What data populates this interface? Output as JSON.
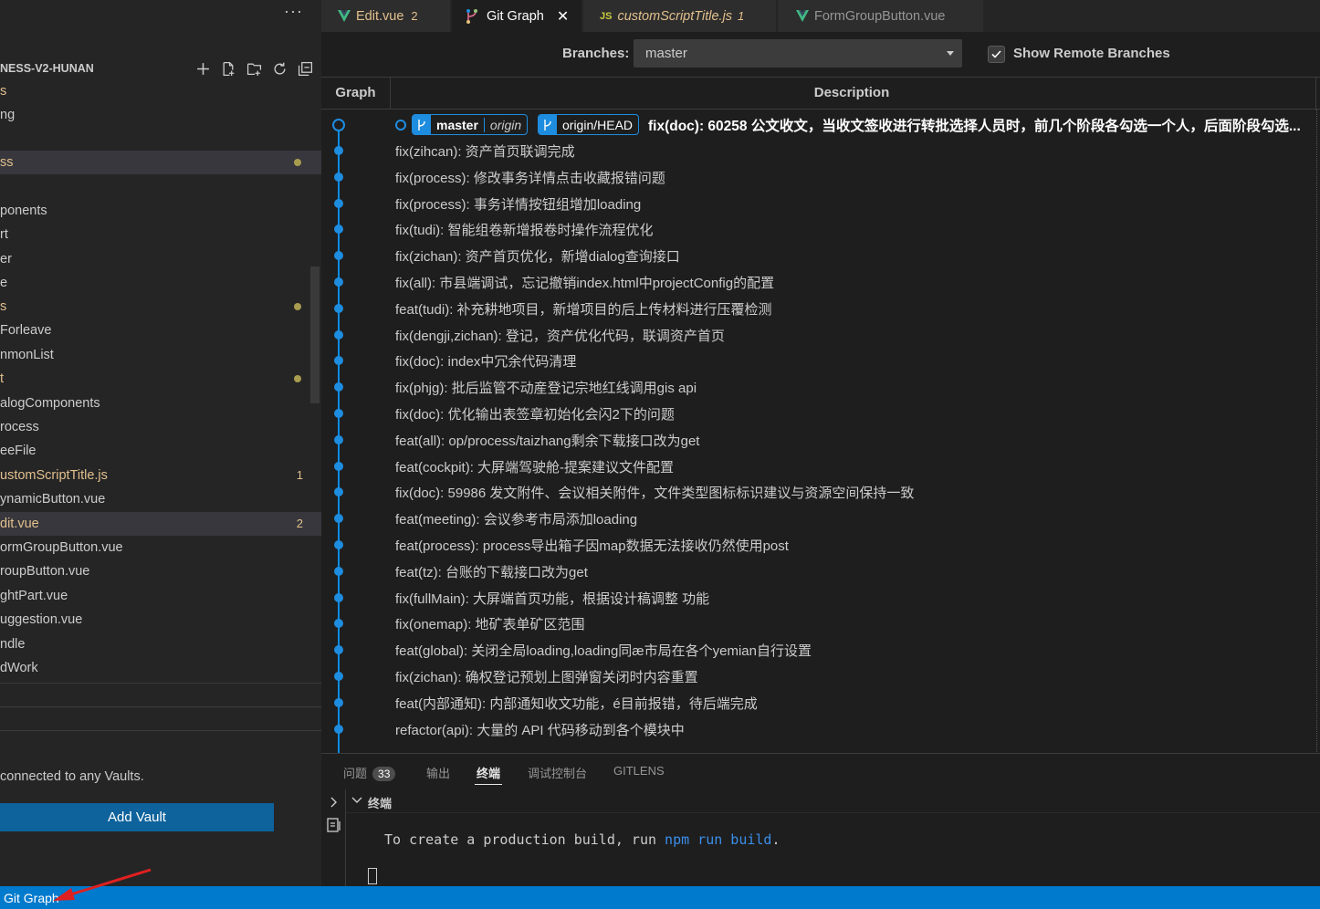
{
  "sidebar": {
    "more_label": "···",
    "project_title": "NESS-V2-HUNAN",
    "items": [
      {
        "label": "s",
        "mod": true,
        "sel": false,
        "dot": false,
        "count": ""
      },
      {
        "label": "ng",
        "mod": false,
        "sel": false,
        "dot": false,
        "count": ""
      },
      {
        "label": "ss",
        "mod": true,
        "sel": true,
        "dot": true,
        "count": ""
      },
      {
        "label": "ponents",
        "mod": false,
        "sel": false,
        "dot": false,
        "count": ""
      },
      {
        "label": "rt",
        "mod": false,
        "sel": false,
        "dot": false,
        "count": ""
      },
      {
        "label": "er",
        "mod": false,
        "sel": false,
        "dot": false,
        "count": ""
      },
      {
        "label": "e",
        "mod": false,
        "sel": false,
        "dot": false,
        "count": ""
      },
      {
        "label": "s",
        "mod": true,
        "sel": false,
        "dot": true,
        "count": ""
      },
      {
        "label": "Forleave",
        "mod": false,
        "sel": false,
        "dot": false,
        "count": ""
      },
      {
        "label": "nmonList",
        "mod": false,
        "sel": false,
        "dot": false,
        "count": ""
      },
      {
        "label": "t",
        "mod": true,
        "sel": false,
        "dot": true,
        "count": ""
      },
      {
        "label": "alogComponents",
        "mod": false,
        "sel": false,
        "dot": false,
        "count": ""
      },
      {
        "label": "rocess",
        "mod": false,
        "sel": false,
        "dot": false,
        "count": ""
      },
      {
        "label": "eeFile",
        "mod": false,
        "sel": false,
        "dot": false,
        "count": ""
      },
      {
        "label": "ustomScriptTitle.js",
        "mod": true,
        "sel": false,
        "dot": false,
        "count": "1"
      },
      {
        "label": "ynamicButton.vue",
        "mod": false,
        "sel": false,
        "dot": false,
        "count": ""
      },
      {
        "label": "dit.vue",
        "mod": true,
        "sel": true,
        "dot": false,
        "count": "2"
      },
      {
        "label": "ormGroupButton.vue",
        "mod": false,
        "sel": false,
        "dot": false,
        "count": ""
      },
      {
        "label": "roupButton.vue",
        "mod": false,
        "sel": false,
        "dot": false,
        "count": ""
      },
      {
        "label": "ghtPart.vue",
        "mod": false,
        "sel": false,
        "dot": false,
        "count": ""
      },
      {
        "label": "uggestion.vue",
        "mod": false,
        "sel": false,
        "dot": false,
        "count": ""
      },
      {
        "label": "ndle",
        "mod": false,
        "sel": false,
        "dot": false,
        "count": ""
      },
      {
        "label": "dWork",
        "mod": false,
        "sel": false,
        "dot": false,
        "count": ""
      }
    ],
    "vault_message": "connected to any Vaults.",
    "add_vault_label": "Add Vault"
  },
  "tabs": [
    {
      "label": "Edit.vue",
      "badge": "2",
      "type": "vue",
      "active": false,
      "modified": true
    },
    {
      "label": "Git Graph",
      "badge": "",
      "type": "git",
      "active": true,
      "modified": false
    },
    {
      "label": "customScriptTitle.js",
      "badge": "1",
      "type": "js",
      "active": false,
      "modified": true
    },
    {
      "label": "FormGroupButton.vue",
      "badge": "",
      "type": "vue",
      "active": false,
      "modified": false
    }
  ],
  "git_graph": {
    "branches_label": "Branches:",
    "branch_selected": "master",
    "show_remote_label": "Show Remote Branches",
    "show_remote_checked": true,
    "col_graph": "Graph",
    "col_description": "Description",
    "head": {
      "branch": "master",
      "remote": "origin",
      "remote_head": "origin/HEAD",
      "message": "fix(doc): 60258 公文收文，当收文签收进行转批选择人员时，前几个阶段各勾选一个人，后面阶段勾选..."
    },
    "commits": [
      "fix(zihcan): 资产首页联调完成",
      "fix(process): 修改事务详情点击收藏报错问题",
      "fix(process): 事务详情按钮组增加loading",
      "fix(tudi): 智能组卷新增报卷时操作流程优化",
      "fix(zichan): 资产首页优化，新增dialog查询接口",
      "fix(all): 市县端调试，忘记撤销index.html中projectConfig的配置",
      "feat(tudi): 补充耕地项目，新增项目的后上传材料进行压覆检测",
      "fix(dengji,zichan): 登记，资产优化代码，联调资产首页",
      "fix(doc): index中冗余代码清理",
      "fix(phjg): 批后监管不动産登记宗地红线调用gis api",
      "fix(doc): 优化输出表签章初始化会闪2下的问题",
      "feat(all): op/process/taizhang剩余下载接口改为get",
      "feat(cockpit): 大屏端驾驶舱-提案建议文件配置",
      "fix(doc): 59986 发文附件、会议相关附件，文件类型图标标识建议与资源空间保持一致",
      "feat(meeting): 会议参考市局添加loading",
      "feat(process): process导出箱子因map数据无法接收仍然使用post",
      "feat(tz): 台账的下载接口改为get",
      "fix(fullMain): 大屏端首页功能，根据设计稿调整 功能",
      "fix(onemap): 地矿表单矿区范围",
      "feat(global): 关闭全局loading,loading同æ市局在各个yemian自行设置",
      "fix(zichan): 确权登记预划上图弹窗关闭时内容重置",
      "feat(内部通知): 内部通知收文功能，é目前报错，待后端完成",
      "refactor(api): 大量的 API 代码移动到各个模块中"
    ]
  },
  "panel": {
    "tabs": [
      {
        "label": "问题",
        "badge": "33",
        "active": false
      },
      {
        "label": "输出",
        "badge": "",
        "active": false
      },
      {
        "label": "终端",
        "badge": "",
        "active": true
      },
      {
        "label": "调试控制台",
        "badge": "",
        "active": false
      },
      {
        "label": "GITLENS",
        "badge": "",
        "active": false
      }
    ],
    "terminal_title": "终端",
    "terminal_text_prefix": "To create a production build, run ",
    "terminal_cmd": "npm run build",
    "terminal_text_suffix": "."
  },
  "statusbar": {
    "git_graph_label": "Git Graph"
  },
  "colors": {
    "accent": "#007acc",
    "graph": "#1e8de0",
    "modified": "#e2c08d"
  }
}
